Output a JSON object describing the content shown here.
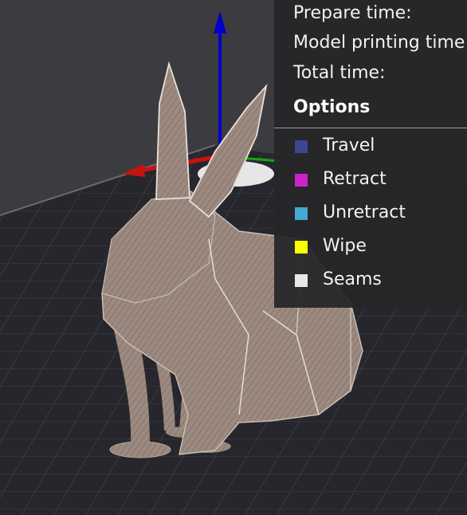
{
  "stats": {
    "prepare_time_label": "Prepare time:",
    "model_printing_time_label": "Model printing time:",
    "total_time_label": "Total time:"
  },
  "options": {
    "title": "Options",
    "items": [
      {
        "label": "Travel",
        "color": "#3c4691"
      },
      {
        "label": "Retract",
        "color": "#cc22cc"
      },
      {
        "label": "Unretract",
        "color": "#44a8d0"
      },
      {
        "label": "Wipe",
        "color": "#ffff00"
      },
      {
        "label": "Seams",
        "color": "#e8e8e8"
      }
    ]
  },
  "scene": {
    "background_color": "#3a3a3f",
    "plate_color": "#25252b",
    "model_color": "#9c8a80",
    "axis_colors": {
      "z": "#0000cc",
      "x": "#cc1111",
      "y": "#11aa11"
    },
    "model_name": "rabbit-model"
  }
}
